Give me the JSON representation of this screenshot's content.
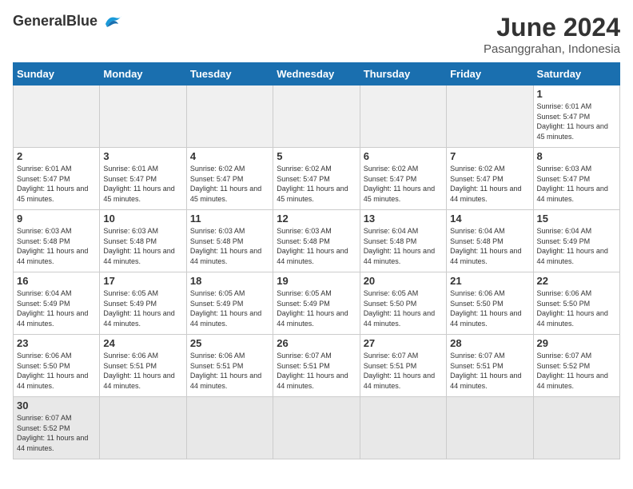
{
  "logo": {
    "general": "General",
    "blue": "Blue"
  },
  "header": {
    "title": "June 2024",
    "subtitle": "Pasanggrahan, Indonesia"
  },
  "weekdays": [
    "Sunday",
    "Monday",
    "Tuesday",
    "Wednesday",
    "Thursday",
    "Friday",
    "Saturday"
  ],
  "weeks": [
    [
      {
        "day": "",
        "empty": true
      },
      {
        "day": "",
        "empty": true
      },
      {
        "day": "",
        "empty": true
      },
      {
        "day": "",
        "empty": true
      },
      {
        "day": "",
        "empty": true
      },
      {
        "day": "",
        "empty": true
      },
      {
        "day": "1",
        "sunrise": "Sunrise: 6:01 AM",
        "sunset": "Sunset: 5:47 PM",
        "daylight": "Daylight: 11 hours and 45 minutes."
      }
    ],
    [
      {
        "day": "2",
        "sunrise": "Sunrise: 6:01 AM",
        "sunset": "Sunset: 5:47 PM",
        "daylight": "Daylight: 11 hours and 45 minutes."
      },
      {
        "day": "3",
        "sunrise": "Sunrise: 6:01 AM",
        "sunset": "Sunset: 5:47 PM",
        "daylight": "Daylight: 11 hours and 45 minutes."
      },
      {
        "day": "4",
        "sunrise": "Sunrise: 6:02 AM",
        "sunset": "Sunset: 5:47 PM",
        "daylight": "Daylight: 11 hours and 45 minutes."
      },
      {
        "day": "5",
        "sunrise": "Sunrise: 6:02 AM",
        "sunset": "Sunset: 5:47 PM",
        "daylight": "Daylight: 11 hours and 45 minutes."
      },
      {
        "day": "6",
        "sunrise": "Sunrise: 6:02 AM",
        "sunset": "Sunset: 5:47 PM",
        "daylight": "Daylight: 11 hours and 45 minutes."
      },
      {
        "day": "7",
        "sunrise": "Sunrise: 6:02 AM",
        "sunset": "Sunset: 5:47 PM",
        "daylight": "Daylight: 11 hours and 44 minutes."
      },
      {
        "day": "8",
        "sunrise": "Sunrise: 6:03 AM",
        "sunset": "Sunset: 5:47 PM",
        "daylight": "Daylight: 11 hours and 44 minutes."
      }
    ],
    [
      {
        "day": "9",
        "sunrise": "Sunrise: 6:03 AM",
        "sunset": "Sunset: 5:48 PM",
        "daylight": "Daylight: 11 hours and 44 minutes."
      },
      {
        "day": "10",
        "sunrise": "Sunrise: 6:03 AM",
        "sunset": "Sunset: 5:48 PM",
        "daylight": "Daylight: 11 hours and 44 minutes."
      },
      {
        "day": "11",
        "sunrise": "Sunrise: 6:03 AM",
        "sunset": "Sunset: 5:48 PM",
        "daylight": "Daylight: 11 hours and 44 minutes."
      },
      {
        "day": "12",
        "sunrise": "Sunrise: 6:03 AM",
        "sunset": "Sunset: 5:48 PM",
        "daylight": "Daylight: 11 hours and 44 minutes."
      },
      {
        "day": "13",
        "sunrise": "Sunrise: 6:04 AM",
        "sunset": "Sunset: 5:48 PM",
        "daylight": "Daylight: 11 hours and 44 minutes."
      },
      {
        "day": "14",
        "sunrise": "Sunrise: 6:04 AM",
        "sunset": "Sunset: 5:48 PM",
        "daylight": "Daylight: 11 hours and 44 minutes."
      },
      {
        "day": "15",
        "sunrise": "Sunrise: 6:04 AM",
        "sunset": "Sunset: 5:49 PM",
        "daylight": "Daylight: 11 hours and 44 minutes."
      }
    ],
    [
      {
        "day": "16",
        "sunrise": "Sunrise: 6:04 AM",
        "sunset": "Sunset: 5:49 PM",
        "daylight": "Daylight: 11 hours and 44 minutes."
      },
      {
        "day": "17",
        "sunrise": "Sunrise: 6:05 AM",
        "sunset": "Sunset: 5:49 PM",
        "daylight": "Daylight: 11 hours and 44 minutes."
      },
      {
        "day": "18",
        "sunrise": "Sunrise: 6:05 AM",
        "sunset": "Sunset: 5:49 PM",
        "daylight": "Daylight: 11 hours and 44 minutes."
      },
      {
        "day": "19",
        "sunrise": "Sunrise: 6:05 AM",
        "sunset": "Sunset: 5:49 PM",
        "daylight": "Daylight: 11 hours and 44 minutes."
      },
      {
        "day": "20",
        "sunrise": "Sunrise: 6:05 AM",
        "sunset": "Sunset: 5:50 PM",
        "daylight": "Daylight: 11 hours and 44 minutes."
      },
      {
        "day": "21",
        "sunrise": "Sunrise: 6:06 AM",
        "sunset": "Sunset: 5:50 PM",
        "daylight": "Daylight: 11 hours and 44 minutes."
      },
      {
        "day": "22",
        "sunrise": "Sunrise: 6:06 AM",
        "sunset": "Sunset: 5:50 PM",
        "daylight": "Daylight: 11 hours and 44 minutes."
      }
    ],
    [
      {
        "day": "23",
        "sunrise": "Sunrise: 6:06 AM",
        "sunset": "Sunset: 5:50 PM",
        "daylight": "Daylight: 11 hours and 44 minutes."
      },
      {
        "day": "24",
        "sunrise": "Sunrise: 6:06 AM",
        "sunset": "Sunset: 5:51 PM",
        "daylight": "Daylight: 11 hours and 44 minutes."
      },
      {
        "day": "25",
        "sunrise": "Sunrise: 6:06 AM",
        "sunset": "Sunset: 5:51 PM",
        "daylight": "Daylight: 11 hours and 44 minutes."
      },
      {
        "day": "26",
        "sunrise": "Sunrise: 6:07 AM",
        "sunset": "Sunset: 5:51 PM",
        "daylight": "Daylight: 11 hours and 44 minutes."
      },
      {
        "day": "27",
        "sunrise": "Sunrise: 6:07 AM",
        "sunset": "Sunset: 5:51 PM",
        "daylight": "Daylight: 11 hours and 44 minutes."
      },
      {
        "day": "28",
        "sunrise": "Sunrise: 6:07 AM",
        "sunset": "Sunset: 5:51 PM",
        "daylight": "Daylight: 11 hours and 44 minutes."
      },
      {
        "day": "29",
        "sunrise": "Sunrise: 6:07 AM",
        "sunset": "Sunset: 5:52 PM",
        "daylight": "Daylight: 11 hours and 44 minutes."
      }
    ],
    [
      {
        "day": "30",
        "sunrise": "Sunrise: 6:07 AM",
        "sunset": "Sunset: 5:52 PM",
        "daylight": "Daylight: 11 hours and 44 minutes."
      },
      {
        "day": "",
        "empty": true
      },
      {
        "day": "",
        "empty": true
      },
      {
        "day": "",
        "empty": true
      },
      {
        "day": "",
        "empty": true
      },
      {
        "day": "",
        "empty": true
      },
      {
        "day": "",
        "empty": true
      }
    ]
  ]
}
